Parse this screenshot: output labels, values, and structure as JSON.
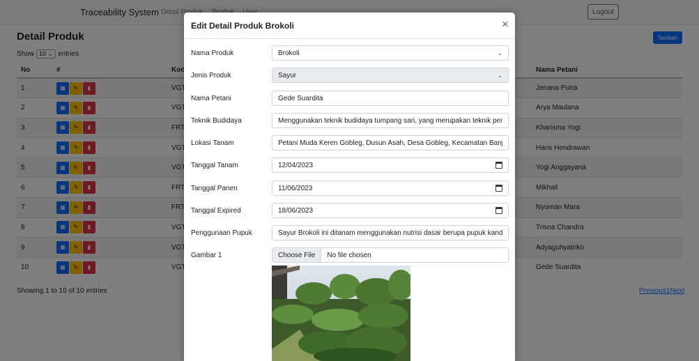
{
  "navbar": {
    "brand": "Traceability System",
    "links": [
      "Detail Produk",
      "Produk",
      "User"
    ],
    "logout_label": "Logout"
  },
  "page": {
    "title": "Detail Produk",
    "add_label": "Tambah",
    "show_label": "Show",
    "entries_value": "10",
    "entries_label": "entries",
    "showing_text": "Showing 1 to 10 of 10 entries",
    "pagination": "Previous1Next"
  },
  "table": {
    "headers": {
      "no": "No",
      "actions": "#",
      "kode": "Kod",
      "nama_petani": "Nama Petani"
    },
    "rows": [
      {
        "no": "1",
        "kode": "VGT",
        "nama_petani": "Jenana Putra"
      },
      {
        "no": "2",
        "kode": "VGT",
        "nama_petani": "Arya Maulana"
      },
      {
        "no": "3",
        "kode": "FRT",
        "nama_petani": "Kharisma Yogi"
      },
      {
        "no": "4",
        "kode": "VGT",
        "nama_petani": "Haris Hendrawan"
      },
      {
        "no": "5",
        "kode": "VGT",
        "nama_petani": "Yogi Anggayana"
      },
      {
        "no": "6",
        "kode": "FRT",
        "nama_petani": "Mikhail"
      },
      {
        "no": "7",
        "kode": "FRT",
        "nama_petani": "Nyoman Mara"
      },
      {
        "no": "8",
        "kode": "VGT",
        "nama_petani": "Trisna Chandra"
      },
      {
        "no": "9",
        "kode": "VGT",
        "nama_petani": "Adyaguhyatriko"
      },
      {
        "no": "10",
        "kode": "VGT",
        "nama_petani": "Gede Suardita"
      }
    ],
    "action_icons": [
      "view-grid-icon",
      "edit-icon",
      "trash-icon"
    ]
  },
  "modal": {
    "title": "Edit Detail Produk Brokoli",
    "close_symbol": "×",
    "fields": {
      "nama_produk": {
        "label": "Nama Produk",
        "value": "Brokoli"
      },
      "jenis_produk": {
        "label": "Jenis Produk",
        "value": "Sayur"
      },
      "nama_petani": {
        "label": "Nama Petani",
        "value": "Gede Suardita"
      },
      "teknik_budidaya": {
        "label": "Teknik Budidaya",
        "value": "Menggunakan teknik budidaya tumpang sari, yang merupakan teknik penar"
      },
      "lokasi_tanam": {
        "label": "Lokasi Tanam",
        "value": "Petani Muda Keren Gobleg, Dusun Asah, Desa Gobleg, Kecamatan Banjar, K"
      },
      "tanggal_tanam": {
        "label": "Tanggal Tanam",
        "value": "12/04/2023"
      },
      "tanggal_panen": {
        "label": "Tanggal Panen",
        "value": "11/06/2023"
      },
      "tanggal_expired": {
        "label": "Tanggal Expired",
        "value": "18/06/2023"
      },
      "penggunaan_pupuk": {
        "label": "Penggunaan Pupuk",
        "value": "Sayur Brokoli ini ditanam menggunakan nutrisi dasar berupa pupuk kandang"
      },
      "gambar_1": {
        "label": "Gambar 1",
        "choose_label": "Choose File",
        "status": "No file chosen"
      }
    }
  },
  "colors": {
    "primary": "#0d6efd",
    "warning": "#ffc107",
    "danger": "#dc3545",
    "backdrop": "rgba(0,0,0,0.5)"
  }
}
